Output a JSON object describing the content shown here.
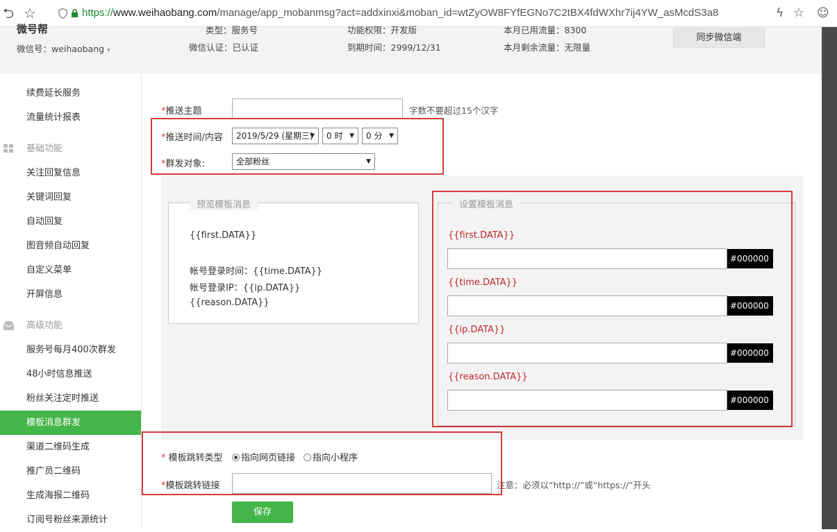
{
  "browser": {
    "url_scheme": "https://",
    "url_host": "www.weihaobang.com",
    "url_path": "/manage/app_mobanmsg?act=addxinxi&moban_id=wtZyOW8FYfEGNo7C2tBX4fdWXhr7ij4YW_asMcdS3a8"
  },
  "header": {
    "account_title_partial": "微号帮",
    "wechat_id": "微信号：weihaobang",
    "type_partial": "类型：服务号",
    "perm_partial": "功能权限：开发版",
    "used_partial": "本月已用流量：8300",
    "verify": "微信认证：已认证",
    "expire": "到期时间：2999/12/31",
    "remain": "本月剩余流量：无限量",
    "sync_button": "同步微信端"
  },
  "sidebar": {
    "items_top": [
      "续费延长服务",
      "流量统计报表"
    ],
    "group_basic": "基础功能",
    "items_basic": [
      "关注回复信息",
      "关键词回复",
      "自动回复",
      "图音频自动回复",
      "自定义菜单",
      "开屏信息"
    ],
    "group_advanced": "高级功能",
    "items_advanced": [
      "服务号每月400次群发",
      "48小时信息推送",
      "粉丝关注定时推送",
      "模板消息群发",
      "渠道二维码生成",
      "推广员二维码",
      "生成海报二维码",
      "订阅号粉丝来源统计"
    ]
  },
  "form": {
    "req_mark": "*",
    "subject_label": "推送主题",
    "subject_value": "",
    "subject_hint": "字数不要超过15个汉字",
    "time_label": "推送时间/内容",
    "date_value": "2019/5/29 (星期三)",
    "hour_value": "0 时",
    "minute_value": "0 分",
    "target_label": "群发对象:",
    "target_value": "全部粉丝",
    "jump_type_label": "模板跳转类型",
    "jump_type_options": [
      "指向网页链接",
      "指向小程序"
    ],
    "jump_type_selected": 0,
    "jump_link_label": "模板跳转链接",
    "jump_link_value": "",
    "jump_link_hint": "注意：必须以“http://”或“https://”开头",
    "save_button": "保存"
  },
  "preview": {
    "legend": "预览模板消息",
    "lines": [
      "{{first.DATA}}",
      "帐号登录时间：{{time.DATA}}",
      "帐号登录IP：{{ip.DATA}}",
      "{{reason.DATA}}"
    ]
  },
  "settings": {
    "legend": "设置模板消息",
    "fields": [
      {
        "key": "{{first.DATA}}",
        "value": "",
        "color": "#000000"
      },
      {
        "key": "{{time.DATA}}",
        "value": "",
        "color": "#000000"
      },
      {
        "key": "{{ip.DATA}}",
        "value": "",
        "color": "#000000"
      },
      {
        "key": "{{reason.DATA}}",
        "value": "",
        "color": "#000000"
      }
    ]
  },
  "colors": {
    "accent": "#44b549",
    "highlight": "#d43a3a",
    "required": "#d9363e",
    "template_key": "#c0262c"
  }
}
